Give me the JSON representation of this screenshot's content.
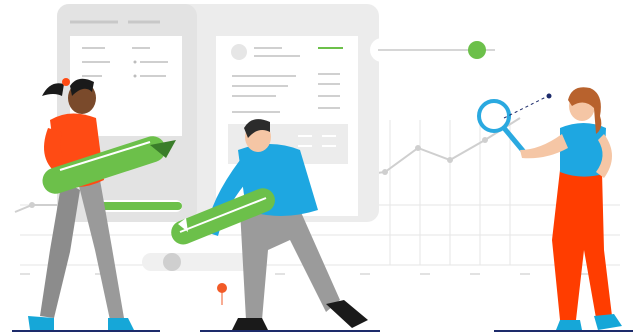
{
  "illustration": {
    "subject": "team-collaboration",
    "colors": {
      "accent_green": "#6cc04a",
      "dark_green": "#3a7d2a",
      "light_gray": "#ececec",
      "mid_gray": "#cfcfcf",
      "panel_white": "#ffffff",
      "blue_shirt": "#1ea7e1",
      "orange_shirt": "#ff4b14",
      "red_orange_pants": "#ff3d00",
      "gray_pants": "#8c8c8c",
      "teal_shoes": "#16a7d8",
      "skin_dark": "#7a4a2b",
      "skin_light": "#f5c6a5",
      "hair_brown": "#b8622d",
      "hair_dark": "#1a1a1a",
      "magnifier_blue": "#2aa9e0",
      "dot_red": "#f25a27",
      "navy": "#1d2b6b"
    },
    "icons": [
      "pencil-icon",
      "magnifier-icon",
      "user-avatar-icon",
      "chevron-left-icon"
    ]
  }
}
